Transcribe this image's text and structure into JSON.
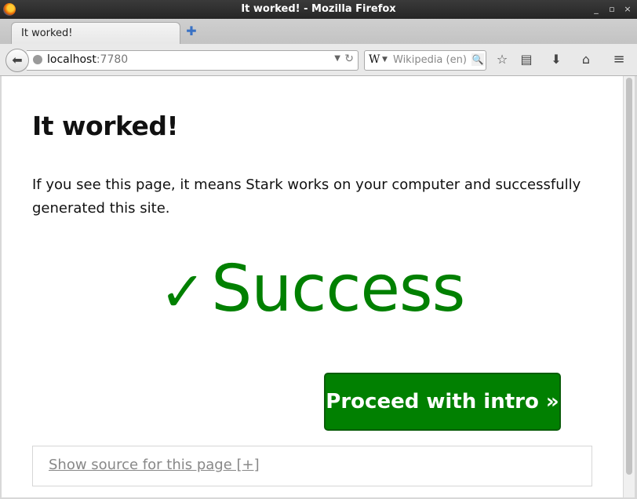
{
  "window": {
    "title": "It worked! - Mozilla Firefox",
    "controls": [
      "_",
      "▫",
      "×"
    ]
  },
  "tabs": [
    {
      "label": "It worked!",
      "active": true
    }
  ],
  "newtab_glyph": "✚",
  "navbar": {
    "url_host": "localhost",
    "url_port": ":7780",
    "search_engine_glyph": "W",
    "search_placeholder": "Wikipedia (en)"
  },
  "page": {
    "title": "It worked!",
    "intro": "If you see this page, it means Stark works on your computer and successfully generated this site.",
    "success_check": "✓",
    "success_text": "Success",
    "proceed_label": "Proceed with intro »",
    "source_link": "Show source for this page [+]"
  },
  "colors": {
    "success_green": "#018001",
    "link_gray": "#888888"
  },
  "icons": {
    "back": "back-arrow-icon",
    "bookmark_star": "star-icon",
    "reading_list": "list-icon",
    "downloads": "download-icon",
    "home": "home-icon",
    "menu": "hamburger-menu-icon"
  }
}
